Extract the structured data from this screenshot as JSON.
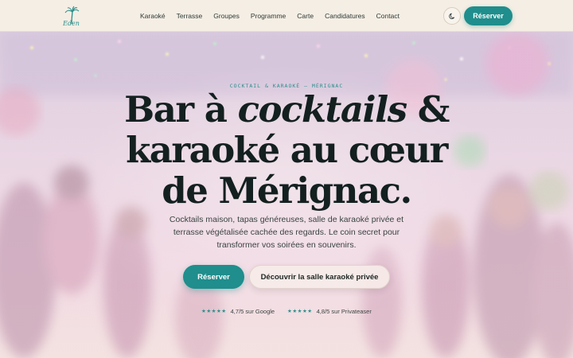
{
  "header": {
    "logo_text": "Eden",
    "nav": [
      "Karaoké",
      "Terrasse",
      "Groupes",
      "Programme",
      "Carte",
      "Candidatures",
      "Contact"
    ],
    "theme_toggle_icon": "moon-icon",
    "reserve_label": "Réserver"
  },
  "hero": {
    "eyebrow": "COCKTAIL & KARAOKÉ — MÉRIGNAC",
    "headline": {
      "line1_a": "Bar à ",
      "line1_em": "cocktails",
      "line1_b": " &",
      "line2": "karaoké au cœur",
      "line3": "de Mérignac."
    },
    "subtitle": "Cocktails maison, tapas généreuses, salle de karaoké privée et terrasse végétalisée cachée des regards. Le coin secret pour transformer vos soirées en souvenirs.",
    "cta_primary": "Réserver",
    "cta_secondary": "Découvrir la salle karaoké privée",
    "ratings": [
      {
        "stars": "★★★★★",
        "text": "4,7/5 sur Google"
      },
      {
        "stars": "★★★★★",
        "text": "4,8/5 sur Privateaser"
      }
    ]
  },
  "colors": {
    "accent": "#1f8e8c",
    "header_bg": "#f5eee4",
    "headline": "#13201f"
  }
}
